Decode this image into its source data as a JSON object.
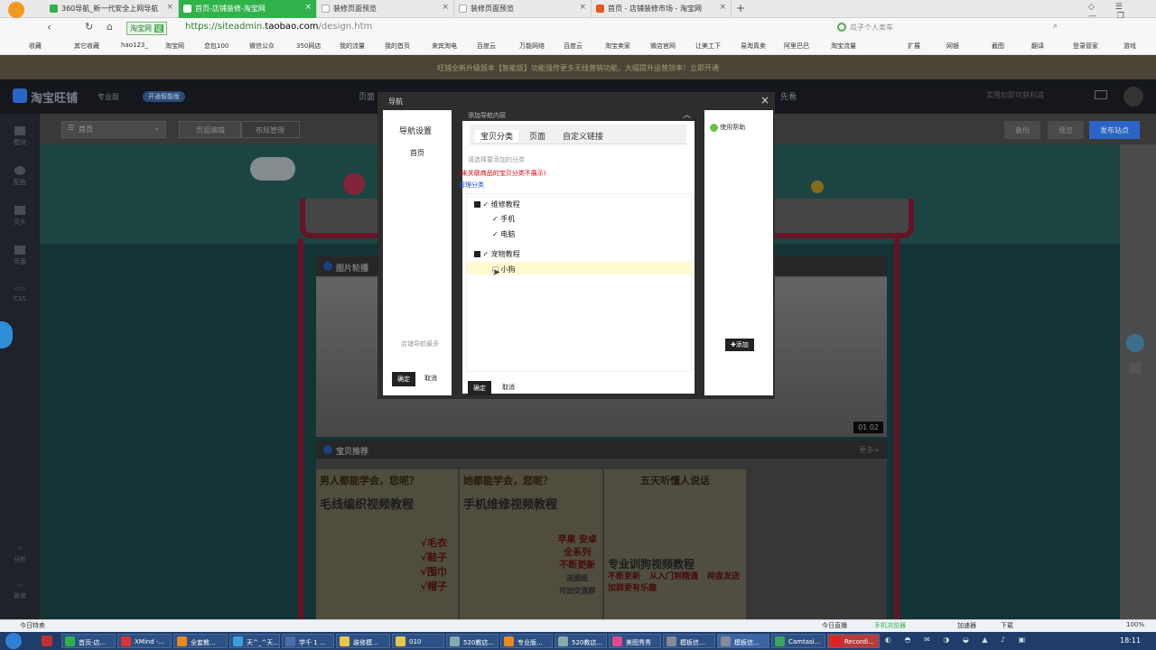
{
  "browser": {
    "tabs": [
      {
        "label": "360导航_新一代安全上网导航",
        "active": false
      },
      {
        "label": "首页-店铺装修-淘宝网",
        "active": true
      },
      {
        "label": "装修页面预览",
        "active": false
      },
      {
        "label": "装修页面预览",
        "active": false
      },
      {
        "label": "首页 - 店铺装修市场 - 淘宝网",
        "active": false
      }
    ],
    "new_tab_symbol": "+",
    "site_badge": "淘宝网",
    "site_cert": "证",
    "url_prefix": "https://siteadmin.",
    "url_domain": "taobao.com",
    "url_path": "/design.htm",
    "search_hint": "瓜子个人卖车",
    "bookmarks": [
      "收藏",
      "其它收藏",
      "hao123_",
      "淘宝网",
      "恋包100",
      "微信公众",
      "350网店",
      "我的流量",
      "我的首页",
      "来宾淘电",
      "百度云",
      "万能网络",
      "百度云",
      "淘宝卖家",
      "微店官网",
      "让美工下",
      "易淘真卖",
      "阿里巴巴",
      "淘宝流量"
    ],
    "bookmarks_right": [
      "扩展",
      "网银",
      "截图",
      "翻译",
      "登录管家",
      "游戏"
    ]
  },
  "page": {
    "notice": "旺铺全新升级版本【智能版】功能强传更多无线营销功能，大幅提升运营效率！立即开通",
    "brand": "淘宝旺铺",
    "edition": "专业版",
    "edition_badge": "开通智能版",
    "top_nav": "页面",
    "top_right_hint": "先看",
    "top_right_text": "实用扣即可获利减",
    "left_menu": [
      "模块",
      "配色",
      "页头",
      "页面",
      "CSS",
      "分析",
      "装修"
    ],
    "page_select": "首页",
    "toolbar_tabs": [
      "页面编辑",
      "布局管理"
    ],
    "toolbar_actions": [
      "备份",
      "预览",
      "发布站点"
    ],
    "module_titles": {
      "carousel": "图片轮播",
      "recommend": "宝贝推荐",
      "more": "更多>"
    },
    "carousel_pages": [
      "01",
      "02"
    ],
    "banners": [
      {
        "headline": "男人都能学会，您呢？",
        "title": "毛线编织视频教程",
        "lines": [
          "√毛衣",
          "√鞋子",
          "√围巾",
          "√帽子"
        ]
      },
      {
        "headline": "她都能学会，您呢？",
        "title": "手机维修视频教程",
        "lines": [
          "苹果 安卓",
          "全系列",
          "不断更新",
          "送图纸",
          "可加交流群"
        ]
      },
      {
        "headline": "五天听懂人说话",
        "title": "专业训狗视频教程",
        "lines": [
          "不断更新",
          "从入门到精通",
          "网盘发送",
          "加群更有乐趣"
        ]
      }
    ]
  },
  "dialog": {
    "title": "导航",
    "close": "×",
    "left_tabs": [
      "导航设置"
    ],
    "nav_items": [
      "首页"
    ],
    "nav_hint": "店铺导航最多",
    "confirm": "确定",
    "cancel": "取消",
    "help": "使用帮助",
    "add": "添加",
    "inner": {
      "title": "添加导航内容",
      "collapse": "︿",
      "tabs": [
        "宝贝分类",
        "页面",
        "自定义链接"
      ],
      "hint": "请选择要添加的分类",
      "warning": "(未关联商品的宝贝分类不展示)",
      "manage": "管理分类",
      "tree": [
        {
          "label": "维修教程",
          "checked": true,
          "children": [
            {
              "label": "手机",
              "checked": true
            },
            {
              "label": "电脑",
              "checked": true
            }
          ]
        },
        {
          "label": "宠物教程",
          "checked": true,
          "children": [
            {
              "label": "小狗",
              "checked": false
            }
          ]
        }
      ],
      "confirm": "确定",
      "cancel": "取消"
    }
  },
  "statusbar": {
    "left": "今日特卖",
    "items": [
      "今日直播",
      "手机浏览器",
      "加速器",
      "下载",
      "100%"
    ]
  },
  "taskbar": {
    "items": [
      "首页-店...",
      "XMind -...",
      "全套教...",
      "天^_^天...",
      "学千 1 ...",
      "装修模...",
      "010",
      "520教店...",
      "专业版...",
      "520教店...",
      "美图秀秀",
      "模板信...",
      "模板信...",
      "Camtasi...",
      "Recordi..."
    ],
    "clock": "18:11"
  },
  "colors": {
    "accent_green": "#2fb24a",
    "taobao_blue": "#2b64c7",
    "publish_blue": "#2c63c6",
    "warning_red": "#e0000a",
    "link_blue": "#1e4fcf",
    "selected_row": "#fffbd1"
  }
}
